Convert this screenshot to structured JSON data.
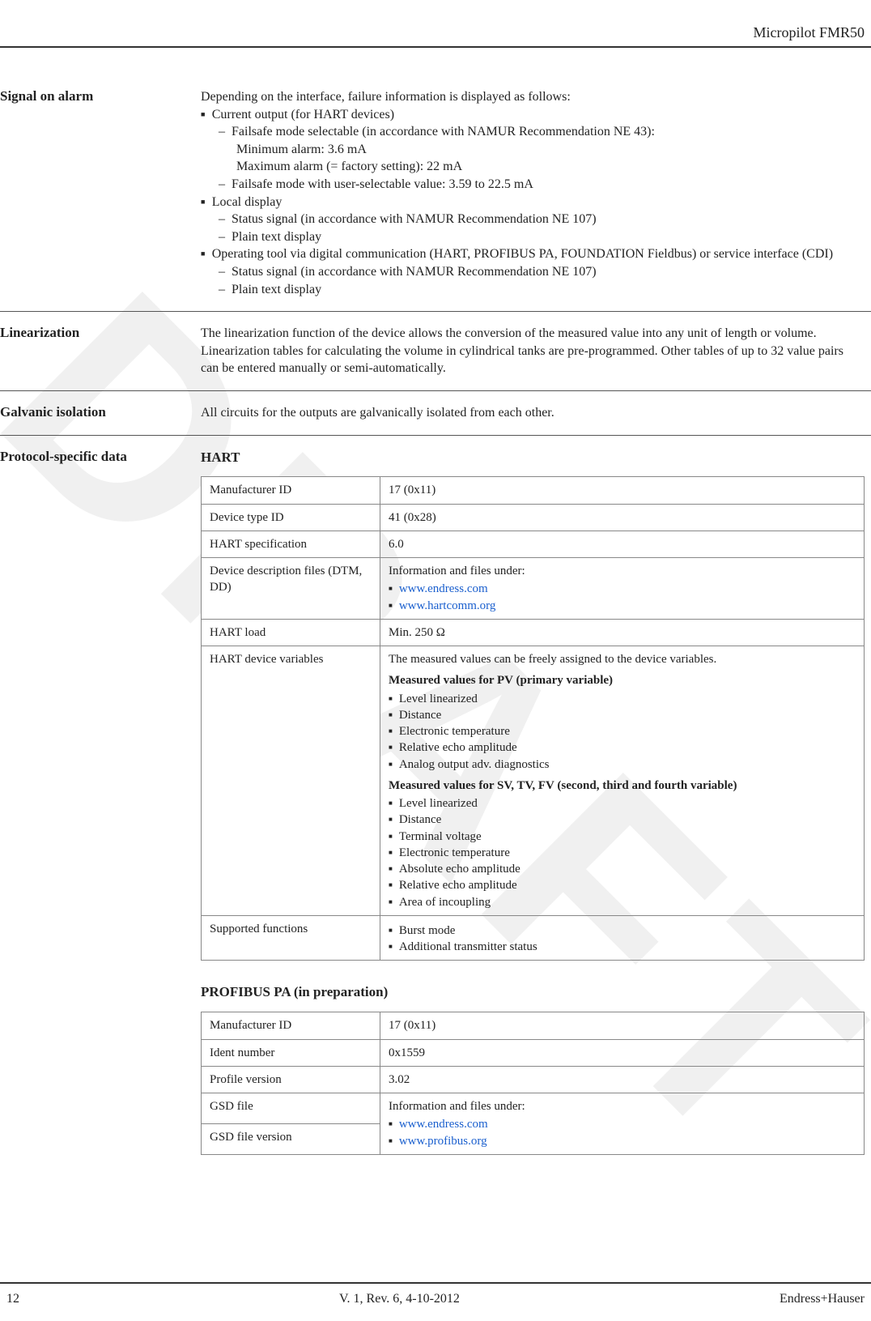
{
  "header": {
    "product": "Micropilot FMR50"
  },
  "watermark": "DRAFT",
  "sections": {
    "signal_on_alarm": {
      "label": "Signal on alarm",
      "intro": "Depending on the interface, failure information is displayed as follows:",
      "b1": "Current output (for HART devices)",
      "b1a": "Failsafe mode selectable (in accordance with NAMUR Recommendation NE 43):",
      "b1a_min": "Minimum alarm: 3.6 mA",
      "b1a_max": "Maximum alarm (= factory setting): 22 mA",
      "b1b": "Failsafe mode with user-selectable value: 3.59 to 22.5 mA",
      "b2": "Local display",
      "b2a": "Status signal (in accordance with NAMUR Recommendation NE 107)",
      "b2b": "Plain text display",
      "b3": "Operating tool via digital communication (HART, PROFIBUS PA, FOUNDATION Fieldbus) or service interface (CDI)",
      "b3a": "Status signal (in accordance with NAMUR Recommendation NE 107)",
      "b3b": "Plain text display"
    },
    "linearization": {
      "label": "Linearization",
      "text": "The linearization function of the device allows the conversion of the measured value into any unit of length or volume. Linearization tables for calculating the volume in cylindrical tanks are pre-programmed. Other tables of up to 32 value pairs can be entered manually or semi-automatically."
    },
    "galvanic": {
      "label": "Galvanic isolation",
      "text": "All circuits for the outputs are galvanically isolated from each other."
    },
    "protocol": {
      "label": "Protocol-specific data",
      "hart_title": "HART",
      "hart": {
        "r1k": "Manufacturer ID",
        "r1v": "17 (0x11)",
        "r2k": "Device type ID",
        "r2v": "41 (0x28)",
        "r3k": "HART specification",
        "r3v": "6.0",
        "r4k": "Device description files (DTM, DD)",
        "r4_intro": "Information and files under:",
        "r4_link1": "www.endress.com",
        "r4_link2": "www.hartcomm.org",
        "r5k": "HART load",
        "r5v": "Min. 250 Ω",
        "r6k": "HART device variables",
        "r6_intro": "The measured values can be freely assigned to the device variables.",
        "r6_pv_title": "Measured values for PV (primary variable)",
        "r6_pv_1": "Level linearized",
        "r6_pv_2": "Distance",
        "r6_pv_3": "Electronic temperature",
        "r6_pv_4": "Relative echo amplitude",
        "r6_pv_5": "Analog output adv. diagnostics",
        "r6_sv_title": "Measured values for SV, TV, FV (second, third and fourth variable)",
        "r6_sv_1": "Level linearized",
        "r6_sv_2": "Distance",
        "r6_sv_3": "Terminal voltage",
        "r6_sv_4": "Electronic temperature",
        "r6_sv_5": "Absolute echo amplitude",
        "r6_sv_6": "Relative echo amplitude",
        "r6_sv_7": "Area of incoupling",
        "r7k": "Supported functions",
        "r7_1": "Burst mode",
        "r7_2": "Additional transmitter status"
      },
      "profibus_title": "PROFIBUS PA (in preparation)",
      "profibus": {
        "r1k": "Manufacturer ID",
        "r1v": "17 (0x11)",
        "r2k": "Ident number",
        "r2v": "0x1559",
        "r3k": "Profile version",
        "r3v": "3.02",
        "r4k": "GSD file",
        "r5k": "GSD file version",
        "r45_intro": "Information and files under:",
        "r45_link1": "www.endress.com",
        "r45_link2": "www.profibus.org"
      }
    }
  },
  "footer": {
    "page": "12",
    "version": "V. 1, Rev. 6, 4-10-2012",
    "company": "Endress+Hauser"
  }
}
